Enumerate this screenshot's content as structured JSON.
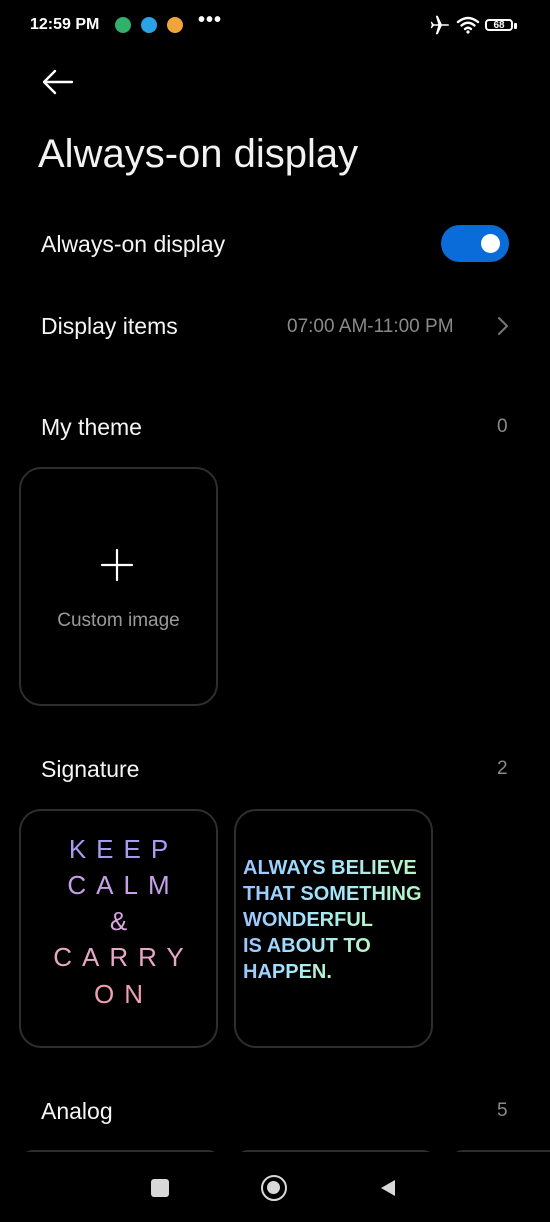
{
  "status_bar": {
    "time": "12:59 PM",
    "battery": "68",
    "more": "•••",
    "colors": {
      "notif1": "#2fb06b",
      "notif2": "#2aa3e6",
      "notif3": "#f0a43a"
    },
    "icons": [
      "shield-icon",
      "cloud-icon",
      "app-icon",
      "airplane-icon",
      "wifi-icon",
      "battery-icon"
    ]
  },
  "header": {
    "title": "Always-on display"
  },
  "settings": {
    "aod_label": "Always-on display",
    "aod_enabled": true,
    "display_items_label": "Display items",
    "display_items_value": "07:00 AM-11:00 PM"
  },
  "my_theme": {
    "label": "My theme",
    "count": "0",
    "custom_label": "Custom image"
  },
  "signature": {
    "label": "Signature",
    "count": "2",
    "card1_lines": [
      "KEEP",
      "CALM",
      "&",
      "CARRY",
      "ON"
    ],
    "card2_lines": [
      "ALWAYS BELIEVE",
      "THAT SOMETHING",
      "WONDERFUL",
      "IS ABOUT TO",
      "HAPPEN."
    ]
  },
  "analog": {
    "label": "Analog",
    "count": "5"
  },
  "accent_color": "#0a6cd9"
}
